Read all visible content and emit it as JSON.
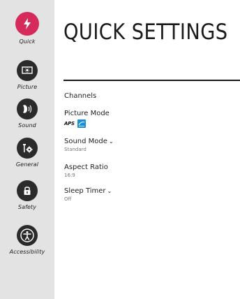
{
  "sidebar": {
    "items": [
      {
        "label": "Quick",
        "icon": "lightning-icon",
        "active": true
      },
      {
        "label": "Picture",
        "icon": "picture-icon"
      },
      {
        "label": "Sound",
        "icon": "sound-icon"
      },
      {
        "label": "General",
        "icon": "general-settings-icon"
      },
      {
        "label": "Safety",
        "icon": "lock-icon"
      },
      {
        "label": "Accessibility",
        "icon": "accessibility-icon"
      }
    ]
  },
  "main": {
    "title": "QUICK SETTINGS",
    "menu": {
      "channels": {
        "label": "Channels"
      },
      "picture_mode": {
        "label": "Picture Mode",
        "badge_aps": "APS"
      },
      "sound_mode": {
        "label": "Sound Mode",
        "chevron": "⌄",
        "value": "Standard"
      },
      "aspect_ratio": {
        "label": "Aspect Ratio",
        "value": "16:9"
      },
      "sleep_timer": {
        "label": "Sleep Timer",
        "chevron": "⌄",
        "value": "Off"
      }
    }
  },
  "colors": {
    "accent": "#d42b5b",
    "sidebar_bg": "#e3e3e3",
    "icon_bg": "#2b2b2b",
    "energy_blue": "#1a8fd8"
  }
}
